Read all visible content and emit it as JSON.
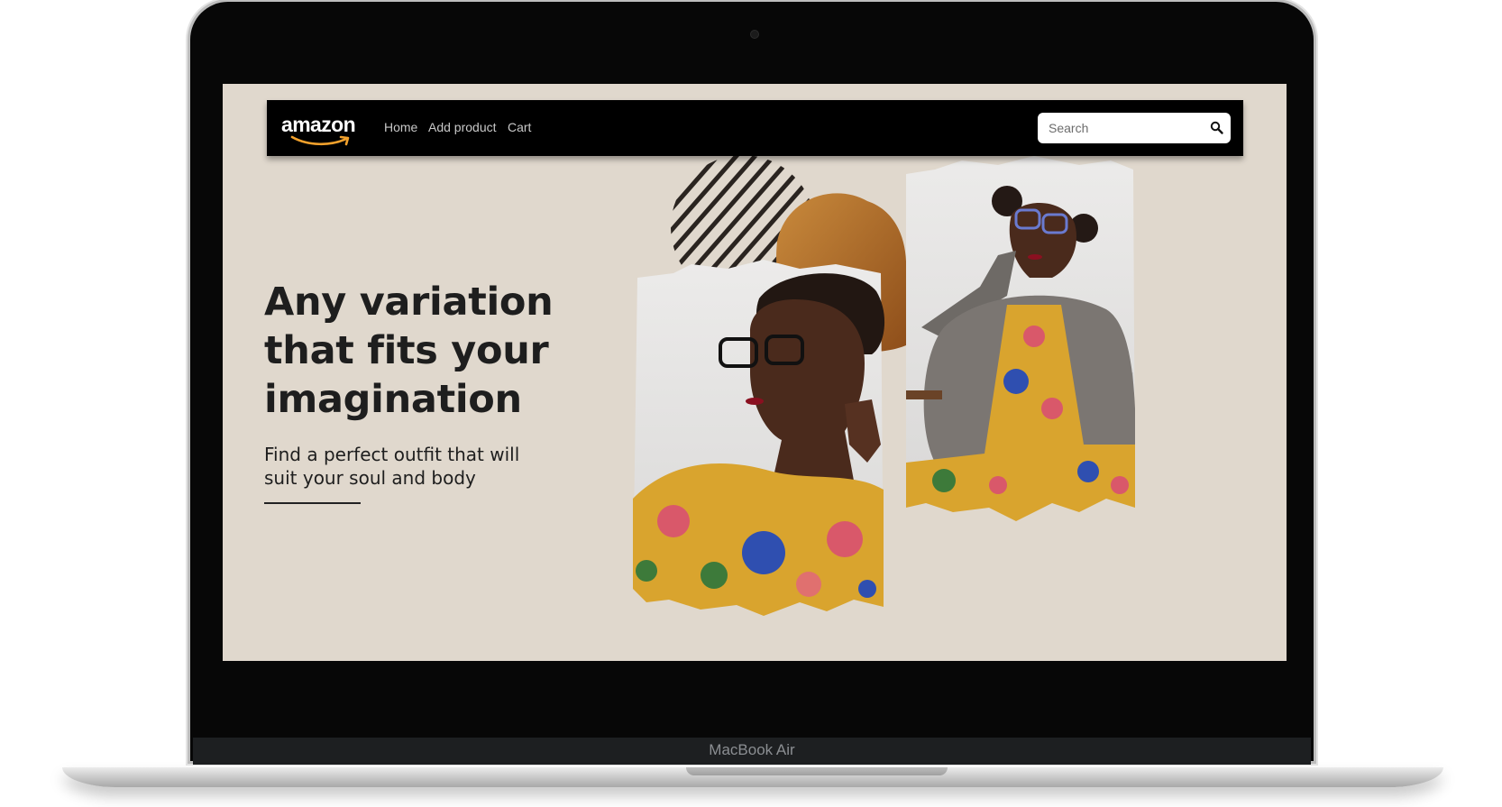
{
  "device": {
    "label": "MacBook Air"
  },
  "navbar": {
    "brand": "amazon",
    "links": [
      "Home",
      "Add product",
      "Cart"
    ],
    "search_placeholder": "Search"
  },
  "hero": {
    "headline_lines": [
      "Any variation",
      "that fits your",
      "imagination"
    ],
    "subhead": "Find a perfect outfit that will suit your soul and body"
  },
  "colors": {
    "page_background": "#e0d8cd",
    "navbar": "#000000",
    "logo_smile": "#f2a12c",
    "accent_circle": "#b46f2c",
    "stripes": "#2a2420"
  },
  "icons": {
    "search": "magnifier-icon",
    "logo": "amazon-smile-logo"
  }
}
